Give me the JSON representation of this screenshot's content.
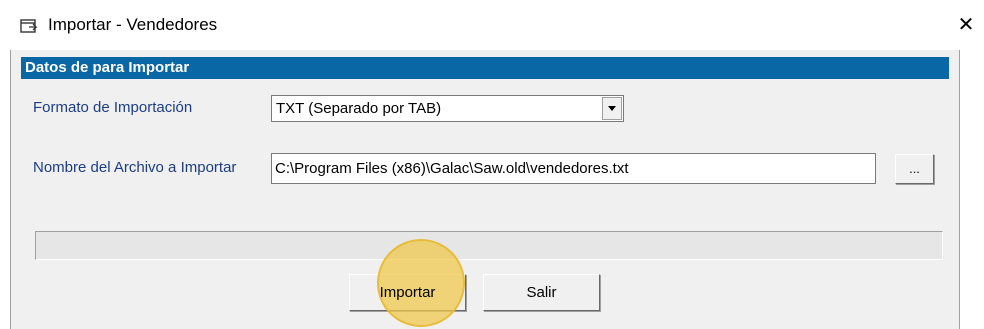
{
  "window": {
    "title": "Importar - Vendedores",
    "close_glyph": "✕",
    "icon": "window-icon"
  },
  "section": {
    "header": "Datos de para  Importar"
  },
  "formato": {
    "label": "Formato de Importación",
    "selected": "TXT (Separado por TAB)"
  },
  "archivo": {
    "label": "Nombre del Archivo a Importar",
    "value": "C:\\Program Files (x86)\\Galac\\Saw.old\\vendedores.txt",
    "browse_label": "..."
  },
  "progress": {
    "value": 0
  },
  "actions": {
    "importar_label": "Importar",
    "salir_label": "Salir"
  },
  "colors": {
    "header_bg": "#0a67a6",
    "label_text": "#1c3d85",
    "dialog_bg": "#f0f0f0",
    "highlight": "#f0c846"
  }
}
